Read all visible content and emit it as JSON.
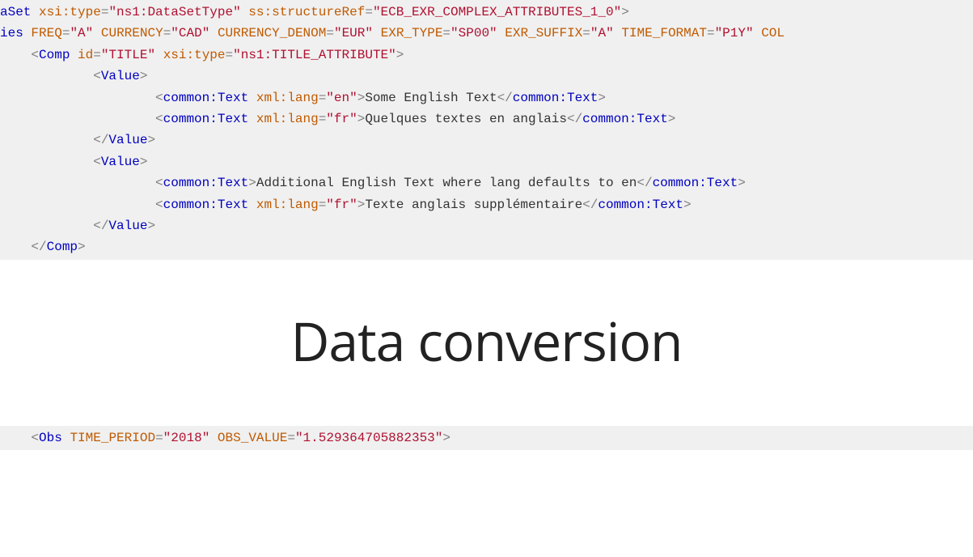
{
  "code_top": {
    "l1": {
      "tag_frag": "aSet",
      "a1": "xsi:type",
      "v1": "ns1:DataSetType",
      "a2": "ss:structureRef",
      "v2": "ECB_EXR_COMPLEX_ATTRIBUTES_1_0"
    },
    "l2": {
      "tag_frag": "ies",
      "a1": "FREQ",
      "v1": "A",
      "a2": "CURRENCY",
      "v2": "CAD",
      "a3": "CURRENCY_DENOM",
      "v3": "EUR",
      "a4": "EXR_TYPE",
      "v4": "SP00",
      "a5": "EXR_SUFFIX",
      "v5": "A",
      "a6": "TIME_FORMAT",
      "v6": "P1Y",
      "a7": "COL"
    },
    "l3": {
      "tag": "Comp",
      "a1": "id",
      "v1": "TITLE",
      "a2": "xsi:type",
      "v2": "ns1:TITLE_ATTRIBUTE"
    },
    "value_open": "Value",
    "ct": "common:Text",
    "lang_attr": "xml:lang",
    "en": "en",
    "fr": "fr",
    "txt_en1": "Some English Text",
    "txt_fr1": "Quelques textes en anglais",
    "txt_en2": "Additional English Text where lang defaults to en",
    "txt_fr2": "Texte anglais supplémentaire",
    "comp_close": "Comp"
  },
  "headline": "Data conversion",
  "code_bottom": {
    "tag": "Obs",
    "a1": "TIME_PERIOD",
    "v1": "2018",
    "a2": "OBS_VALUE",
    "v2": "1.529364705882353"
  }
}
